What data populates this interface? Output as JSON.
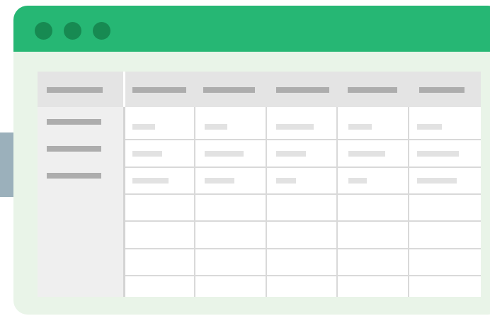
{
  "window": {
    "controls": [
      {
        "icon": "window-dot-icon",
        "color": "#178a52"
      },
      {
        "icon": "window-dot-icon",
        "color": "#178a52"
      },
      {
        "icon": "window-dot-icon",
        "color": "#178a52"
      }
    ]
  },
  "colors": {
    "titlebar": "#26b774",
    "window_body": "#e9f4e8",
    "side_tab": "#9bb0bb",
    "placeholder_dark": "#adadad",
    "placeholder_light": "#e2e2e2"
  },
  "spreadsheet": {
    "column_count": 5,
    "data_row_count": 7,
    "filled_row_count": 3,
    "row_header_count": 3
  }
}
